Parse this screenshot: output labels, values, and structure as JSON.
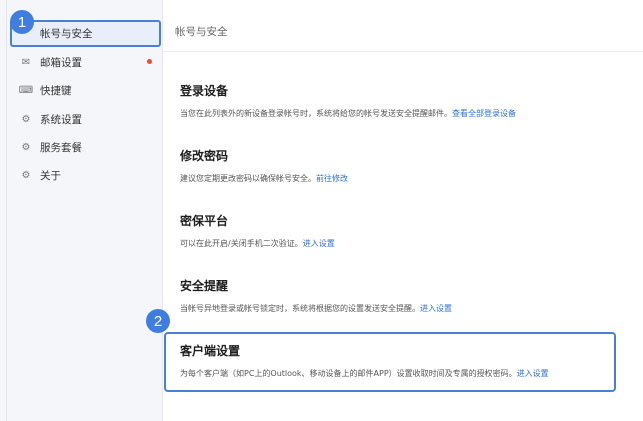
{
  "badges": {
    "first": "1",
    "second": "2"
  },
  "sidebar": {
    "items": [
      {
        "label": "帐号与安全",
        "icon": "account-icon"
      },
      {
        "label": "邮箱设置",
        "icon": "mail-icon",
        "has_dot": true
      },
      {
        "label": "快捷键",
        "icon": "keyboard-icon"
      },
      {
        "label": "系统设置",
        "icon": "settings-icon"
      },
      {
        "label": "服务套餐",
        "icon": "service-icon"
      },
      {
        "label": "关于",
        "icon": "about-icon"
      }
    ]
  },
  "header": {
    "title": "帐号与安全"
  },
  "sections": [
    {
      "title": "登录设备",
      "desc": "当您在此列表外的新设备登录帐号时，系统将给您的帐号发送安全提醒邮件。",
      "link": "查看全部登录设备"
    },
    {
      "title": "修改密码",
      "desc": "建议您定期更改密码以确保帐号安全。",
      "link": "前往修改"
    },
    {
      "title": "密保平台",
      "desc": "可以在此开启/关闭手机二次验证。",
      "link": "进入设置"
    },
    {
      "title": "安全提醒",
      "desc": "当帐号异地登录或帐号锁定时，系统将根据您的设置发送安全提醒。",
      "link": "进入设置"
    },
    {
      "title": "客户端设置",
      "desc": "为每个客户端（如PC上的Outlook、移动设备上的邮件APP）设置收取时间及专属的授权密码。",
      "link": "进入设置"
    }
  ],
  "colors": {
    "accent": "#4a7fd6",
    "link": "#2f6fd6",
    "badge": "#3f7ee0",
    "dot": "#e84a3c"
  }
}
